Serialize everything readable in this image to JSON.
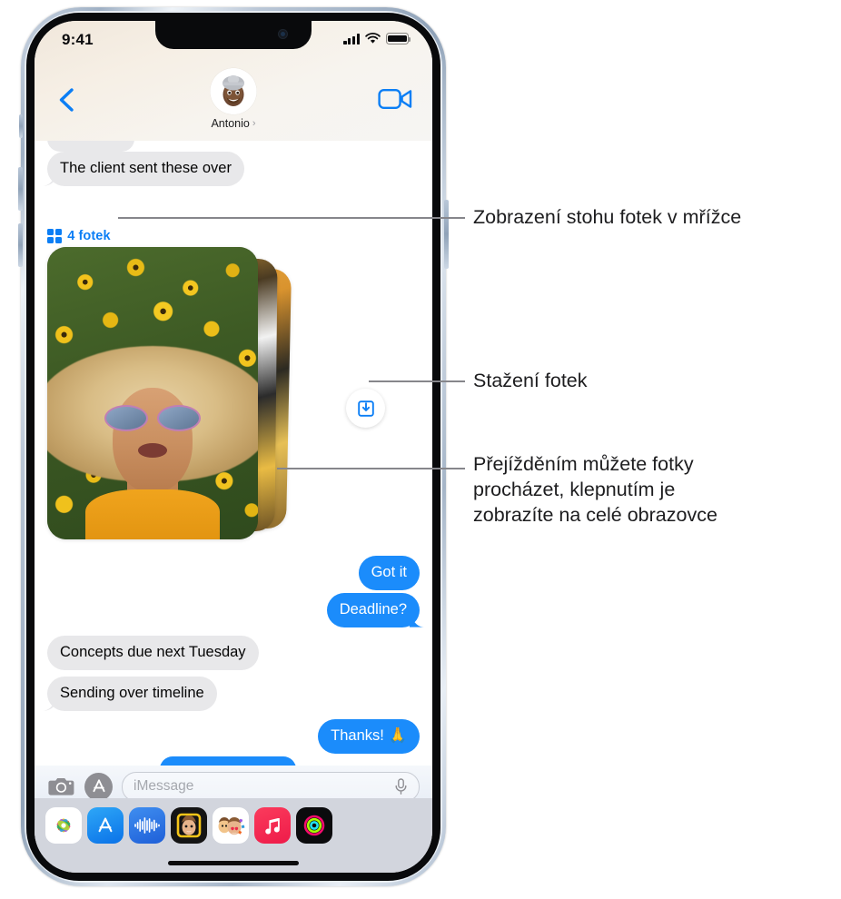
{
  "status_bar": {
    "time": "9:41",
    "cellular_icon": "signal-bars-icon",
    "wifi_icon": "wifi-icon",
    "battery_icon": "battery-full-icon"
  },
  "nav_bar": {
    "back_icon": "chevron-left-icon",
    "contact_name": "Antonio",
    "contact_chevron": "›",
    "avatar_icon": "memoji-avatar",
    "facetime_icon": "video-camera-icon"
  },
  "conversation": {
    "messages": [
      {
        "id": "m0",
        "text": "",
        "side": "them",
        "clipped": true
      },
      {
        "id": "m1",
        "text": "The client sent these over",
        "side": "them"
      },
      {
        "id": "m2",
        "text": "Got it",
        "side": "me"
      },
      {
        "id": "m3",
        "text": "Deadline?",
        "side": "me"
      },
      {
        "id": "m4",
        "text": "Concepts due next Tuesday",
        "side": "them"
      },
      {
        "id": "m5",
        "text": "Sending over timeline",
        "side": "them"
      },
      {
        "id": "m6",
        "text": "Thanks! 🙏",
        "side": "me"
      },
      {
        "id": "m7",
        "text": "",
        "side": "me",
        "clipped": true
      }
    ],
    "photo_stack": {
      "badge_label": "4 fotek",
      "badge_icon": "grid-2x2-icon",
      "badge_color": "#0b7ef5",
      "photo_count": 4,
      "download_icon": "save-to-tray-icon"
    }
  },
  "input_bar": {
    "camera_icon": "camera-icon",
    "apps_icon": "app-store-icon",
    "placeholder": "iMessage",
    "value": "",
    "dictation_icon": "microphone-icon"
  },
  "app_tray": {
    "apps": [
      {
        "name": "photos-app-icon",
        "label": "Photos"
      },
      {
        "name": "app-store-app-icon",
        "label": "App Store"
      },
      {
        "name": "audio-message-app-icon",
        "label": "Audio"
      },
      {
        "name": "memoji-app-icon",
        "label": "Memoji"
      },
      {
        "name": "memoji-stickers-app-icon",
        "label": "Memoji Stickers"
      },
      {
        "name": "music-app-icon",
        "label": "Music"
      },
      {
        "name": "fitness-app-icon",
        "label": "Fitness"
      }
    ]
  },
  "home_indicator": "home-indicator",
  "callouts": [
    {
      "id": "c1",
      "text": "Zobrazení stohu fotek v mřížce"
    },
    {
      "id": "c2",
      "text": "Stažení fotek"
    },
    {
      "id": "c3",
      "text": "Přejížděním můžete fotky\nprocházet, klepnutím je\nzobrazíte na celé obrazovce"
    }
  ],
  "colors": {
    "accent_blue": "#0b7ef5",
    "bubble_me": "#1b8cfb",
    "bubble_them": "#e8e8ea",
    "leader_line": "#86868b",
    "tray_bg": "#d2d5dd"
  }
}
